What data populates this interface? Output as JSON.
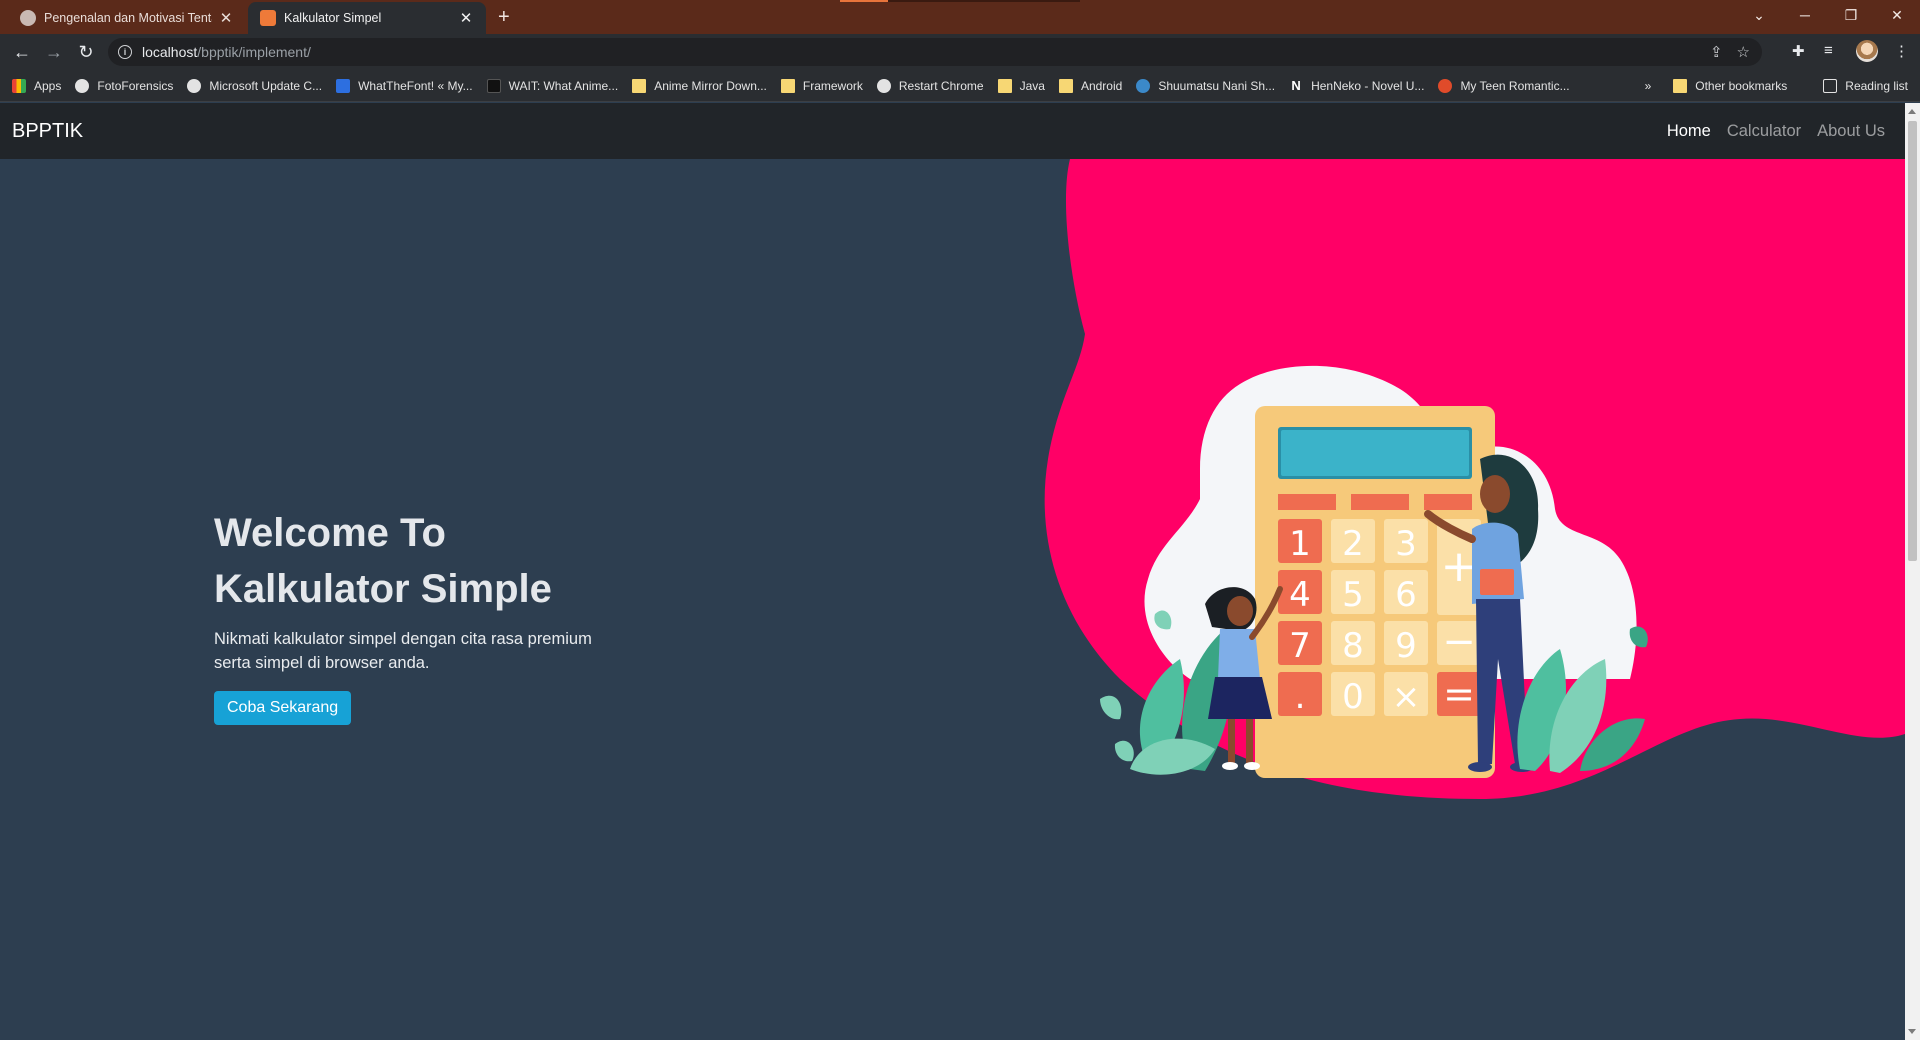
{
  "browser": {
    "tabs": [
      {
        "title": "Pengenalan dan Motivasi Tentang",
        "active": false
      },
      {
        "title": "Kalkulator Simpel",
        "active": true
      }
    ],
    "address": {
      "host": "localhost",
      "path": "/bpptik/implement/"
    },
    "bookmarks": [
      {
        "label": "Apps",
        "icon": "apps-grid-icon"
      },
      {
        "label": "FotoForensics",
        "icon": "globe-icon"
      },
      {
        "label": "Microsoft Update C...",
        "icon": "globe-icon"
      },
      {
        "label": "WhatTheFont! « My...",
        "icon": "whatthefont-icon"
      },
      {
        "label": "WAIT: What Anime...",
        "icon": "wait-icon"
      },
      {
        "label": "Anime Mirror Down...",
        "icon": "folder-icon"
      },
      {
        "label": "Framework",
        "icon": "folder-icon"
      },
      {
        "label": "Restart Chrome",
        "icon": "globe-icon"
      },
      {
        "label": "Java",
        "icon": "folder-icon"
      },
      {
        "label": "Android",
        "icon": "folder-icon"
      },
      {
        "label": "Shuumatsu Nani Sh...",
        "icon": "wordpress-icon"
      },
      {
        "label": "HenNeko - Novel U...",
        "icon": "n-icon"
      },
      {
        "label": "My Teen Romantic...",
        "icon": "reddit-icon"
      }
    ],
    "other_bookmarks": "Other bookmarks",
    "reading_list": "Reading list",
    "more_chevron": "»"
  },
  "navbar": {
    "brand": "BPPTIK",
    "links": [
      {
        "label": "Home",
        "active": true
      },
      {
        "label": "Calculator",
        "active": false
      },
      {
        "label": "About Us",
        "active": false
      }
    ]
  },
  "hero": {
    "title_line1": "Welcome To",
    "title_line2": "Kalkulator Simple",
    "description": "Nikmati kalkulator simpel dengan cita rasa premium serta simpel di browser anda.",
    "cta_label": "Coba Sekarang"
  },
  "illustration": {
    "keys": [
      "1",
      "2",
      "3",
      "4",
      "5",
      "6",
      "7",
      "8",
      "9",
      ".",
      "0",
      "×"
    ],
    "op_keys": [
      "+",
      "−",
      "="
    ]
  },
  "colors": {
    "page_bg": "#2d3e50",
    "navbar_bg": "#212529",
    "blob": "#ff0066",
    "calculator_body": "#f6c97a",
    "calculator_screen": "#3bb3c9",
    "key_accent": "#ef6c50",
    "cta": "#17a2d6"
  }
}
